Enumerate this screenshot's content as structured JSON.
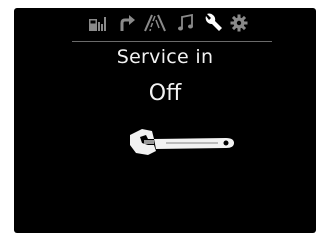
{
  "tabs": [
    {
      "icon": "fuel-icon",
      "active": false
    },
    {
      "icon": "turn-arrow-icon",
      "active": false
    },
    {
      "icon": "lane-road-icon",
      "active": false
    },
    {
      "icon": "music-note-icon",
      "active": false
    },
    {
      "icon": "wrench-icon",
      "active": true
    },
    {
      "icon": "gear-icon",
      "active": false
    }
  ],
  "screen": {
    "title": "Service in",
    "value": "Off",
    "illustration": "wrench-icon"
  },
  "colors": {
    "background": "#000000",
    "text": "#f2f2f2",
    "inactive_icon": "#8a8a8a",
    "active_icon": "#ffffff"
  }
}
